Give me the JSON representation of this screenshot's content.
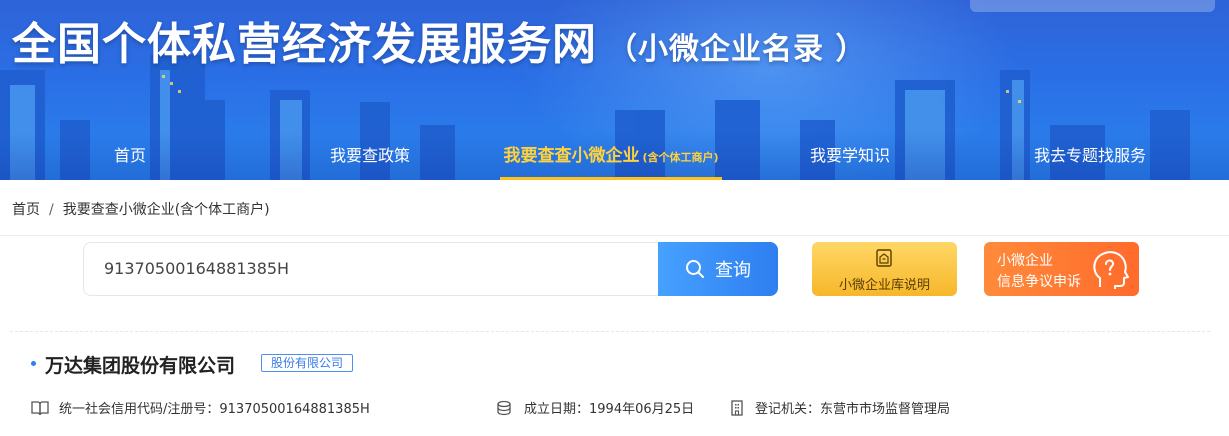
{
  "header": {
    "title": "全国个体私营经济发展服务网",
    "subtitle": "（小微企业名录 ）"
  },
  "nav": {
    "items": [
      {
        "label": "首页"
      },
      {
        "label": "我要查政策"
      },
      {
        "label": "我要查查小微企业",
        "suffix": "(含个体工商户)"
      },
      {
        "label": "我要学知识"
      },
      {
        "label": "我去专题找服务"
      }
    ]
  },
  "breadcrumb": {
    "home": "首页",
    "separator": "/",
    "current": "我要查查小微企业(含个体工商户)"
  },
  "search": {
    "value": "91370500164881385H",
    "button_label": "查询"
  },
  "cards": {
    "library_label": "小微企业库说明",
    "dispute_line1": "小微企业",
    "dispute_line2": "信息争议申诉"
  },
  "result": {
    "company_name": "万达集团股份有限公司",
    "company_type": "股份有限公司",
    "credit_code": "统一社会信用代码/注册号：91370500164881385H",
    "established": "成立日期：1994年06月25日",
    "authority": "登记机关：东营市市场监督管理局"
  },
  "colors": {
    "primary": "#2e7ef0",
    "nav_active": "#ffd23c",
    "card_yellow": "#f6b72a",
    "card_orange": "#ff6b2c"
  }
}
